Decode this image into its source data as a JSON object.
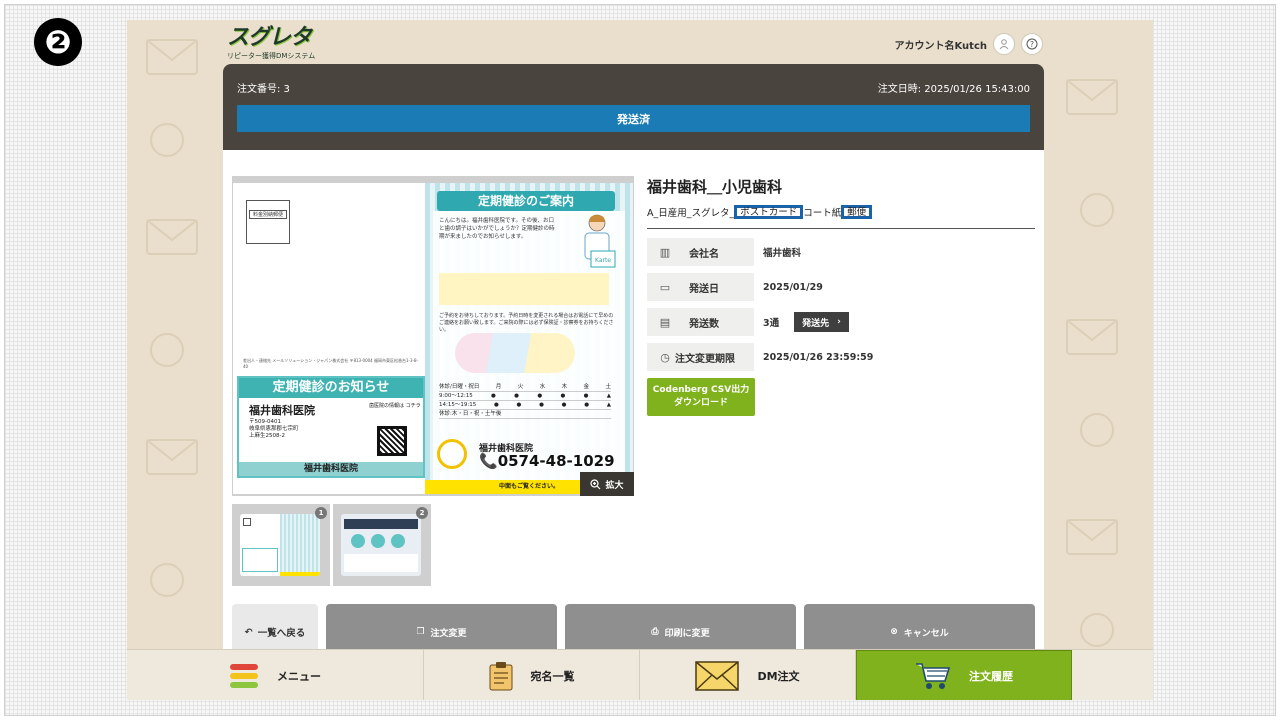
{
  "step": "❷",
  "brand": {
    "logo": "スグレタ",
    "tagline": "リピーター獲得DMシステム"
  },
  "account": {
    "name": "アカウント名Kutch"
  },
  "order": {
    "number": "注文番号: 3",
    "date": "注文日時: 2025/01/26 15:43:00",
    "status": "発送済"
  },
  "preview": {
    "zoom_label": "拡大",
    "stamp_label": "料金別納郵便",
    "sender": "差出人・連絡先 メールソリューション・ジャパン株式会社 〒813-0004 福岡市東区松香台1-3-8-40",
    "notice_title": "定期健診のお知らせ",
    "notice_clinic": "福井歯科医院",
    "notice_addr_lines": [
      "〒509-0401",
      "岐阜県恵那郡七宗町",
      "上麻生2508-2"
    ],
    "notice_side": "歯医院の情報は\nコチラ",
    "notice_foot": "福井歯科医院",
    "right_title": "定期健診のご案内",
    "right_text": "こんにちは。福井歯科医院です。その後、お口と歯の調子はいかがでしょうか？定期健診の時期が来ましたのでお知らせします。",
    "karte": "Karte",
    "right_text2": "ご予約をお待ちしております。予約日時を変更される場合はお電話にて早めのご連絡をお願い致します。ご来院の際には必ず保険証・診察券をお持ちください。",
    "timetable": [
      [
        "休診/日曜・祝日",
        "月",
        "火",
        "水",
        "木",
        "金",
        "土"
      ],
      [
        "9:00〜12:15",
        "●",
        "●",
        "●",
        "●",
        "●",
        "▲"
      ],
      [
        "14:15〜19:15",
        "●",
        "●",
        "●",
        "●",
        "●",
        "▲"
      ],
      [
        "休診:木・日・祝・土午後",
        "",
        "",
        "",
        "",
        "",
        ""
      ]
    ],
    "right_clinic": "福井歯科医院",
    "right_tel": "0574-48-1029",
    "right_foot": "中面もご覧ください。"
  },
  "thumbnails": [
    {
      "num": "1"
    },
    {
      "num": "2"
    }
  ],
  "detail": {
    "title": "福井歯科＿小児歯科",
    "product_prefix": "A_日産用_スグレタ_",
    "product_box1": "ポストカード",
    "product_mid": "コート紙",
    "product_box2": "郵便",
    "rows": [
      {
        "label": "会社名",
        "value": "福井歯科"
      },
      {
        "label": "発送日",
        "value": "2025/01/29"
      },
      {
        "label": "発送数",
        "value": "3通",
        "button": "発送先"
      },
      {
        "label": "注文変更期限",
        "value": "2025/01/26 23:59:59"
      }
    ],
    "csv_line1": "Codenberg CSV出力",
    "csv_line2": "ダウンロード"
  },
  "actions": {
    "back": "一覧へ戻る",
    "change": "注文変更",
    "print": "印刷に変更",
    "cancel": "キャンセル"
  },
  "nav": [
    {
      "label": "メニュー"
    },
    {
      "label": "宛名一覧"
    },
    {
      "label": "DM注文"
    },
    {
      "label": "注文履歴"
    }
  ],
  "colors": {
    "status_blue": "#1b7bb4",
    "header_dark": "#4a443e",
    "accent_green": "#7fb21c",
    "highlight_box": "#1b63a8"
  }
}
